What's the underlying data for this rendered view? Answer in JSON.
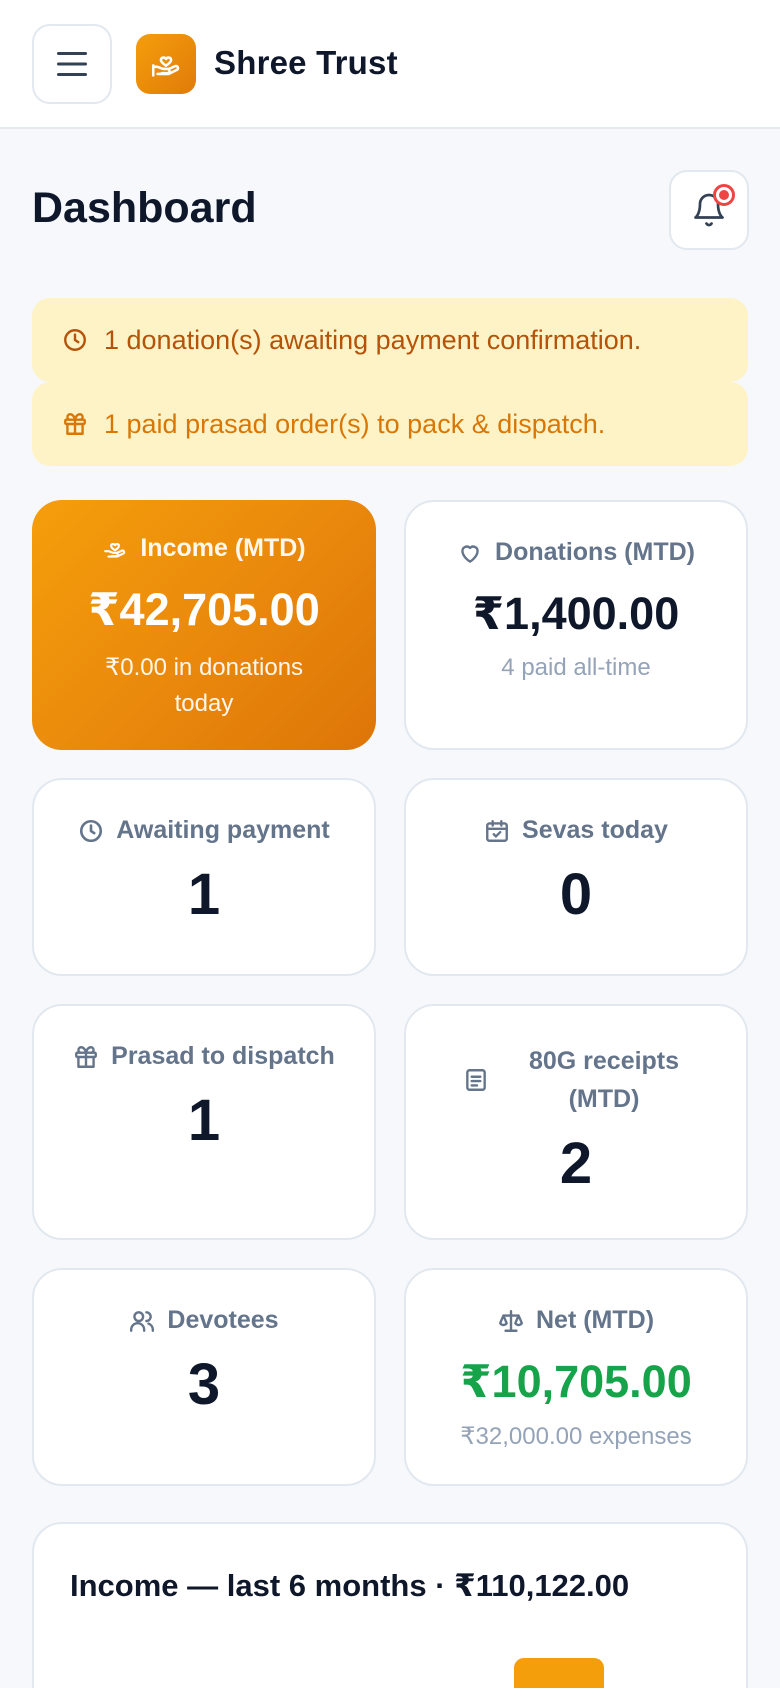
{
  "app": {
    "name": "Shree Trust"
  },
  "page": {
    "title": "Dashboard"
  },
  "alerts": [
    {
      "text": "1 donation(s) awaiting payment confirmation.",
      "icon": "clock-icon"
    },
    {
      "text": "1 paid prasad order(s) to pack & dispatch.",
      "icon": "gift-icon"
    }
  ],
  "cards": {
    "income": {
      "label": "Income (MTD)",
      "value": "₹42,705.00",
      "sub": "₹0.00 in donations today",
      "icon": "hand-heart-icon"
    },
    "donations": {
      "label": "Donations (MTD)",
      "value": "₹1,400.00",
      "sub": "4 paid all-time",
      "icon": "heart-icon"
    },
    "awaiting": {
      "label": "Awaiting payment",
      "value": "1",
      "icon": "clock-icon"
    },
    "sevas": {
      "label": "Sevas today",
      "value": "0",
      "icon": "calendar-icon"
    },
    "prasad": {
      "label": "Prasad to dispatch",
      "value": "1",
      "icon": "gift-icon"
    },
    "receipts": {
      "label": "80G receipts (MTD)",
      "value": "2",
      "icon": "receipt-icon"
    },
    "devotees": {
      "label": "Devotees",
      "value": "3",
      "icon": "users-icon"
    },
    "net": {
      "label": "Net (MTD)",
      "value": "₹10,705.00",
      "sub": "₹32,000.00 expenses",
      "icon": "scale-icon",
      "value_color": "#16a34a"
    }
  },
  "income_chart": {
    "title": "Income — last 6 months · ₹110,122.00"
  },
  "colors": {
    "accent": "#f59e0b",
    "alert_bg": "#fef3c7",
    "positive": "#16a34a"
  }
}
